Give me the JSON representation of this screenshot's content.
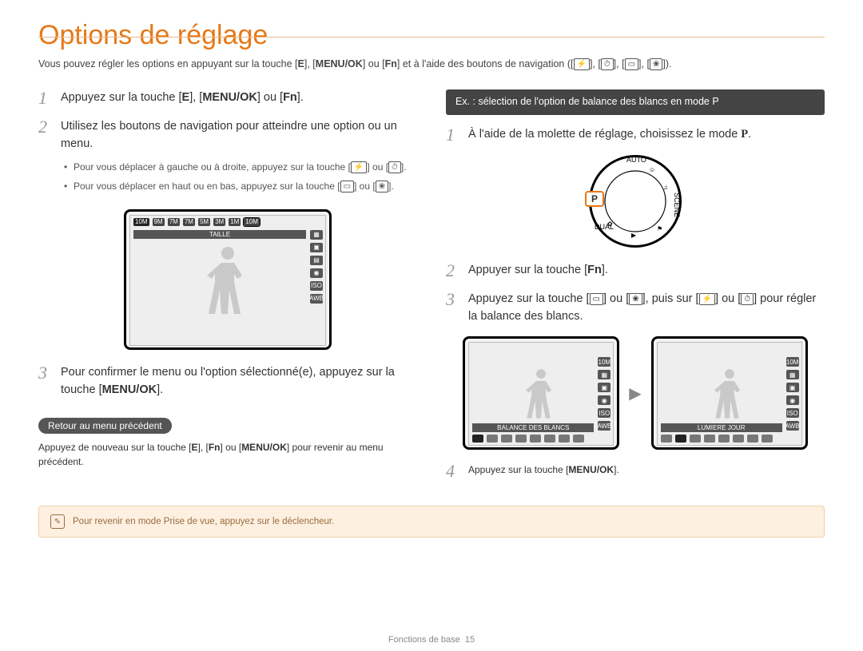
{
  "title": "Options de réglage",
  "intro": {
    "pre": "Vous pouvez régler les options en appuyant sur la touche [",
    "k1": "E",
    "mid1": "], [",
    "k2": "MENU/OK",
    "mid2": "] ou [",
    "k3": "Fn",
    "post": "] et à l'aide des boutons de navigation ("
  },
  "intro_tail": ").",
  "icons": {
    "flash": "⚡",
    "timer": "⏱",
    "disp": "▭",
    "macro": "❀"
  },
  "left": {
    "step1": {
      "pre": "Appuyez sur la touche [",
      "k1": "E",
      "mid1": "], [",
      "k2": "MENU/OK",
      "mid2": "] ou [",
      "k3": "Fn",
      "post": "]."
    },
    "step2": "Utilisez les boutons de navigation pour atteindre une option ou un menu.",
    "b1": {
      "pre": "Pour vous déplacer à gauche ou à droite, appuyez sur la touche [",
      "mid": "] ou [",
      "post": "]."
    },
    "b2": {
      "pre": "Pour vous déplacer en haut ou en bas, appuyez sur la touche [",
      "mid": "] ou [",
      "post": "]."
    },
    "lcd": {
      "title": "TAILLE",
      "top": [
        "10M",
        "9M",
        "7M",
        "7M",
        "5M",
        "3M",
        "1M",
        "10M"
      ],
      "side": [
        "▦",
        "▣",
        "▤",
        "◉",
        "ISO",
        "AWB"
      ]
    },
    "step3": {
      "pre": "Pour confirmer le menu ou l'option sélectionné(e), appuyez sur la touche [",
      "k": "MENU/OK",
      "post": "]."
    },
    "pill": "Retour au menu précédent",
    "return_text": {
      "pre": "Appuyez de nouveau sur la touche [",
      "k1": "E",
      "mid1": "], [",
      "k2": "Fn",
      "mid2": "] ou [",
      "k3": "MENU/OK",
      "post": "] pour revenir au menu précédent."
    }
  },
  "right": {
    "example_title": "Ex. : sélection de l'option de balance des blancs en mode P",
    "step1": {
      "pre": "À l'aide de la molette de réglage, choisissez le mode ",
      "mode": "P",
      "post": "."
    },
    "dial": {
      "sel": "P",
      "labels": [
        "AUTO",
        "SCENE",
        "DUAL"
      ]
    },
    "step2": {
      "pre": "Appuyer sur la touche [",
      "k": "Fn",
      "post": "]."
    },
    "step3": {
      "pre": "Appuyez sur la touche [",
      "mid1": "] ou [",
      "mid2": "], puis sur [",
      "mid3": "] ou [",
      "post": "] pour régler la balance des blancs."
    },
    "lcd1_title": "BALANCE DES BLANCS",
    "lcd2_title": "LUMIERE JOUR",
    "lcd_side": [
      "10M",
      "▦",
      "▣",
      "◉",
      "ISO",
      "AWB"
    ],
    "step4": {
      "pre": "Appuyez sur la touche [",
      "k": "MENU/OK",
      "post": "]."
    }
  },
  "note": "Pour revenir en mode Prise de vue, appuyez sur le déclencheur.",
  "footer": {
    "section": "Fonctions de base",
    "page": "15"
  }
}
